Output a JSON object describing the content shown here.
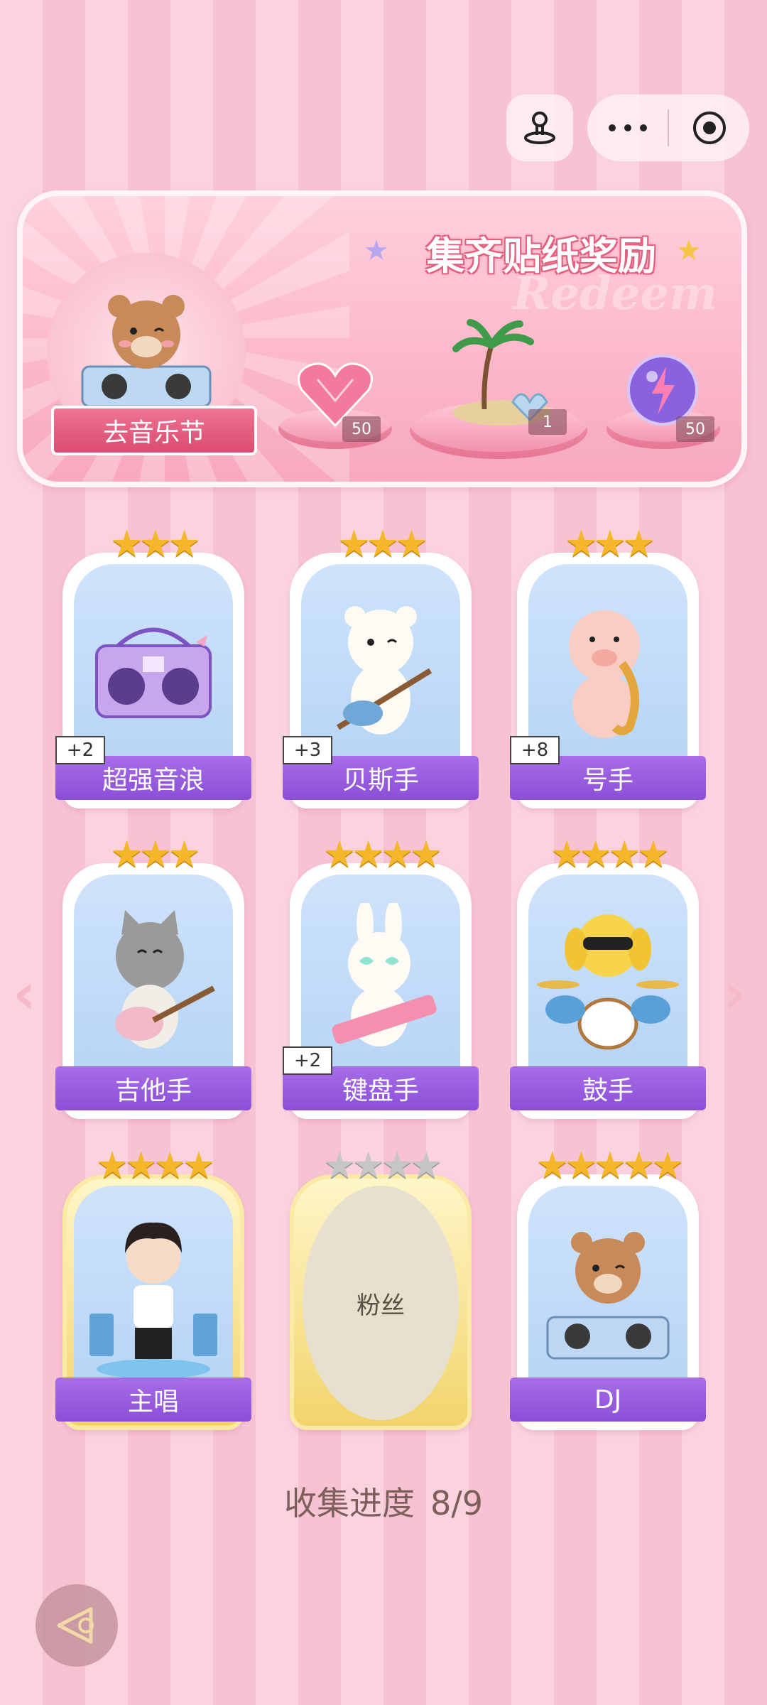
{
  "capsule": {
    "joystick_icon": "joystick-icon",
    "more_icon": "more-dots-icon",
    "close_icon": "target-close-icon"
  },
  "banner": {
    "title": "集齐贴纸奖励",
    "watermark": "Redeem",
    "festival_button": "去音乐节",
    "rewards": [
      {
        "name": "heart-gem",
        "count": "50"
      },
      {
        "name": "island",
        "count": "1"
      },
      {
        "name": "lightning-orb",
        "count": "50"
      }
    ]
  },
  "cards": [
    {
      "label": "超强音浪",
      "stars": "★★★",
      "plus": "+2",
      "owned": true,
      "art": "boombox"
    },
    {
      "label": "贝斯手",
      "stars": "★★★",
      "plus": "+3",
      "owned": true,
      "art": "bear-bass"
    },
    {
      "label": "号手",
      "stars": "★★★",
      "plus": "+8",
      "owned": true,
      "art": "pig-sax"
    },
    {
      "label": "吉他手",
      "stars": "★★★",
      "plus": "",
      "owned": true,
      "art": "cat-guitar"
    },
    {
      "label": "键盘手",
      "stars": "★★★★",
      "plus": "+2",
      "owned": true,
      "art": "bunny-keytar"
    },
    {
      "label": "鼓手",
      "stars": "★★★★",
      "plus": "",
      "owned": true,
      "art": "dog-drums"
    },
    {
      "label": "主唱",
      "stars": "★★★★",
      "plus": "",
      "owned": true,
      "art": "singer"
    },
    {
      "label": "粉丝",
      "stars": "★★★★",
      "plus": "",
      "owned": false,
      "art": "empty"
    },
    {
      "label": "DJ",
      "stars": "★★★★★",
      "plus": "",
      "owned": true,
      "art": "bear-dj"
    }
  ],
  "progress": {
    "label": "收集进度",
    "value": "8/9"
  },
  "nav": {
    "prev": "‹",
    "next": "›"
  }
}
